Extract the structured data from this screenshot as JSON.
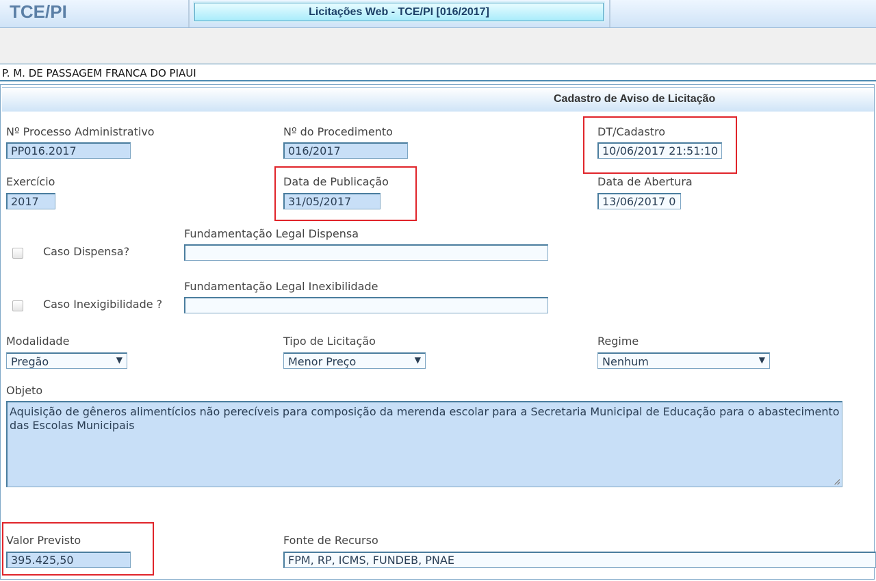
{
  "header": {
    "logo": "TCE/PI",
    "app_title": "Licitações Web - TCE/PI  [016/2017]"
  },
  "organization": "P. M. DE PASSAGEM FRANCA DO PIAUI",
  "section_title": "Cadastro de Aviso de Licitação",
  "fields": {
    "processo_adm": {
      "label": "Nº Processo Administrativo",
      "value": "PP016.2017"
    },
    "procedimento": {
      "label": "Nº do Procedimento",
      "value": "016/2017"
    },
    "dt_cadastro": {
      "label": "DT/Cadastro",
      "value": "10/06/2017 21:51:10"
    },
    "exercicio": {
      "label": "Exercício",
      "value": "2017"
    },
    "data_publicacao": {
      "label": "Data de Publicação",
      "value": "31/05/2017"
    },
    "data_abertura": {
      "label": "Data de Abertura",
      "value": "13/06/2017 0"
    },
    "caso_dispensa": {
      "label": "Caso Dispensa?",
      "checked": false
    },
    "fund_legal_dispensa": {
      "label": "Fundamentação Legal Dispensa",
      "value": ""
    },
    "caso_inexigibilidade": {
      "label": "Caso Inexigibilidade ?",
      "checked": false
    },
    "fund_legal_inexigibilidade": {
      "label": "Fundamentação Legal Inexibilidade",
      "value": ""
    },
    "modalidade": {
      "label": "Modalidade",
      "value": "Pregão"
    },
    "tipo_licitacao": {
      "label": "Tipo de Licitação",
      "value": "Menor Preço"
    },
    "regime": {
      "label": "Regime",
      "value": "Nenhum"
    },
    "objeto": {
      "label": "Objeto",
      "value": "Aquisição de gêneros alimentícios não perecíveis para composição da merenda escolar para a Secretaria Municipal de Educação para o abastecimento das Escolas Municipais"
    },
    "valor_previsto": {
      "label": "Valor Previsto",
      "value": "395.425,50"
    },
    "fonte_recurso": {
      "label": "Fonte de Recurso",
      "value": "FPM, RP, ICMS, FUNDEB, PNAE"
    }
  },
  "icons": {
    "dropdown": "chevron-down-icon"
  },
  "colors": {
    "highlight": "#e0242a",
    "field_bg": "#c8dff7",
    "title_text": "#1b3f66"
  }
}
